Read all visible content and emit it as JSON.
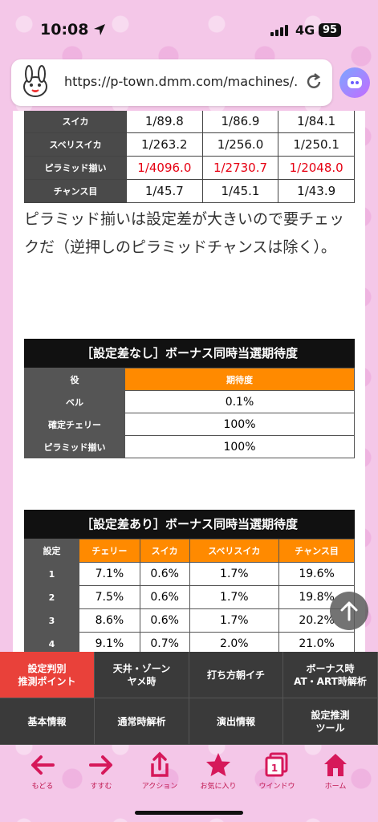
{
  "status": {
    "time": "10:08",
    "network": "4G",
    "battery": "95"
  },
  "browser": {
    "url": "https://p-town.dmm.com/machines/..."
  },
  "prob_table": {
    "rows": [
      {
        "label": "スイカ",
        "values": [
          "1/89.8",
          "1/86.9",
          "1/84.1"
        ]
      },
      {
        "label": "スベリスイカ",
        "values": [
          "1/263.2",
          "1/256.0",
          "1/250.1"
        ]
      },
      {
        "label": "ピラミッド揃い",
        "values": [
          "1/4096.0",
          "1/2730.7",
          "1/2048.0"
        ]
      },
      {
        "label": "チャンス目",
        "values": [
          "1/45.7",
          "1/45.1",
          "1/43.9"
        ]
      }
    ]
  },
  "paragraph": "ピラミッド揃いは設定差が大きいので要チェックだ（逆押しのピラミッドチャンスは除く）。",
  "table_no_diff": {
    "title": "［設定差なし］ボーナス同時当選期待度",
    "headers": [
      "役",
      "期待度"
    ],
    "rows": [
      {
        "label": "ベル",
        "value": "0.1%"
      },
      {
        "label": "確定チェリー",
        "value": "100%"
      },
      {
        "label": "ピラミッド揃い",
        "value": "100%"
      }
    ]
  },
  "table_diff": {
    "title": "［設定差あり］ボーナス同時当選期待度",
    "headers": [
      "設定",
      "チェリー",
      "スイカ",
      "スベリスイカ",
      "チャンス目"
    ],
    "rows": [
      {
        "label": "1",
        "values": [
          "7.1%",
          "0.6%",
          "1.7%",
          "19.6%"
        ]
      },
      {
        "label": "2",
        "values": [
          "7.5%",
          "0.6%",
          "1.7%",
          "19.8%"
        ]
      },
      {
        "label": "3",
        "values": [
          "8.6%",
          "0.6%",
          "1.7%",
          "20.2%"
        ]
      },
      {
        "label": "4",
        "values": [
          "9.1%",
          "0.7%",
          "2.0%",
          "21.0%"
        ]
      }
    ]
  },
  "nav_menu": [
    {
      "label": "設定判別\n推測ポイント",
      "active": true
    },
    {
      "label": "天井・ゾーン\nヤメ時",
      "active": false
    },
    {
      "label": "打ち方朝イチ",
      "active": false
    },
    {
      "label": "ボーナス時\nAT・ART時解析",
      "active": false
    },
    {
      "label": "基本情報",
      "active": false
    },
    {
      "label": "通常時解析",
      "active": false
    },
    {
      "label": "演出情報",
      "active": false
    },
    {
      "label": "設定推測\nツール",
      "active": false
    }
  ],
  "toolbar": {
    "back": "もどる",
    "forward": "すすむ",
    "action": "アクション",
    "favorite": "お気に入り",
    "window": "ウインドウ",
    "window_count": "1",
    "home": "ホーム"
  },
  "colors": {
    "accent": "#ff8a00",
    "red_value": "#e60012",
    "active_menu": "#e9413a",
    "toolbar_icon": "#d6185a"
  }
}
